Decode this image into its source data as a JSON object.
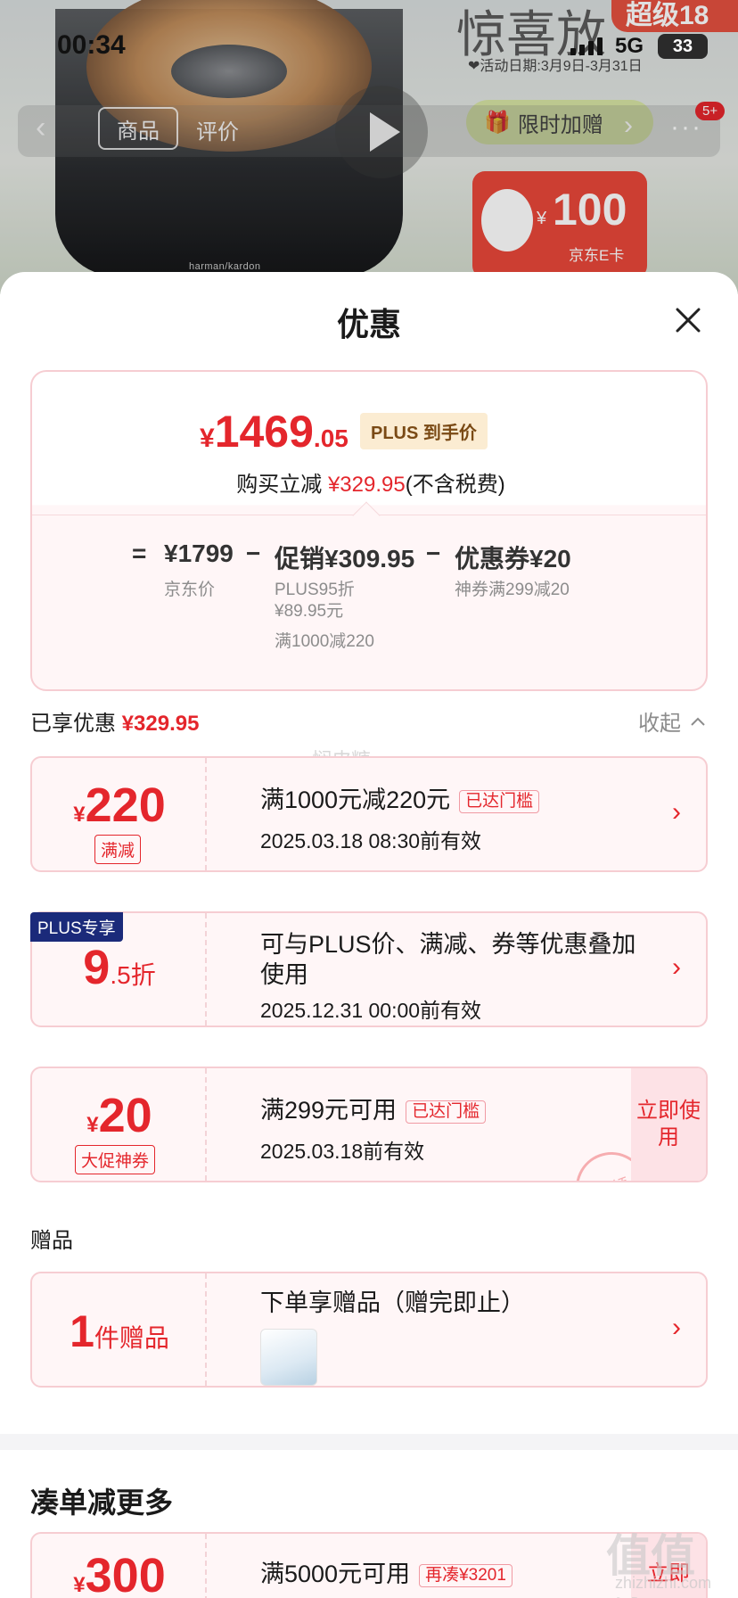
{
  "status_bar": {
    "time": "00:34",
    "network": "5G",
    "battery": "33"
  },
  "background": {
    "promo_title": "惊喜放",
    "super_badge": "超级18",
    "activity_date": "❤活动日期:3月9日-3月31日",
    "gift_pill": "限时加赠",
    "tab_goods": "商品",
    "tab_review": "评价",
    "message_badge": "5+",
    "card_amount": "100",
    "card_currency": "¥",
    "card_label": "京东E卡",
    "speaker_brand": "harman/kardon"
  },
  "sheet": {
    "title": "优惠",
    "summary": {
      "price_symbol": "¥",
      "price_int": "1469",
      "price_dec": ".05",
      "plus_tag": "PLUS 到手价",
      "save_prefix": "购买立减",
      "save_amount": "¥329.95",
      "save_suffix": "(不含税费)",
      "eq": "=",
      "jd_price": "¥1799",
      "jd_price_label": "京东价",
      "minus1": "−",
      "promo": "促销¥309.95",
      "promo_sub1": "PLUS95折",
      "promo_sub2": "¥89.95元",
      "promo_sub3": "满1000减220",
      "minus2": "−",
      "coupon": "优惠券¥20",
      "coupon_sub": "神券满299减20"
    },
    "enjoyed_label": "已享优惠",
    "enjoyed_amount": "¥329.95",
    "collapse_label": "收起",
    "coupons": [
      {
        "symbol": "¥",
        "amount": "220",
        "tag": "满减",
        "title": "满1000元减220元",
        "pill": "已达门槛",
        "validity": "2025.03.18 08:30前有效"
      },
      {
        "corner": "PLUS专享",
        "amount": "9",
        "suffix": ".5折",
        "title_line1": "可与PLUS价、满减、券等优惠叠加",
        "title_line2": "使用",
        "validity": "2025.12.31 00:00前有效"
      },
      {
        "symbol": "¥",
        "amount": "20",
        "tag": "大促神券",
        "title": "满299元可用",
        "pill": "已达门槛",
        "validity": "2025.03.18前有效",
        "action": "立即使用",
        "stamp": "已领"
      }
    ],
    "gift_section": "赠品",
    "gift": {
      "count": "1",
      "unit": "件赠品",
      "title": "下单享赠品（赠完即止）"
    },
    "more_section": "凑单减更多",
    "more_card": {
      "symbol": "¥",
      "amount": "300",
      "title": "满5000元可用",
      "pill": "再凑¥3201",
      "action": "立即"
    },
    "watermark_mid": "悯皮糖",
    "watermark": "值值值",
    "watermark_url": "zhizhizhi.com"
  }
}
